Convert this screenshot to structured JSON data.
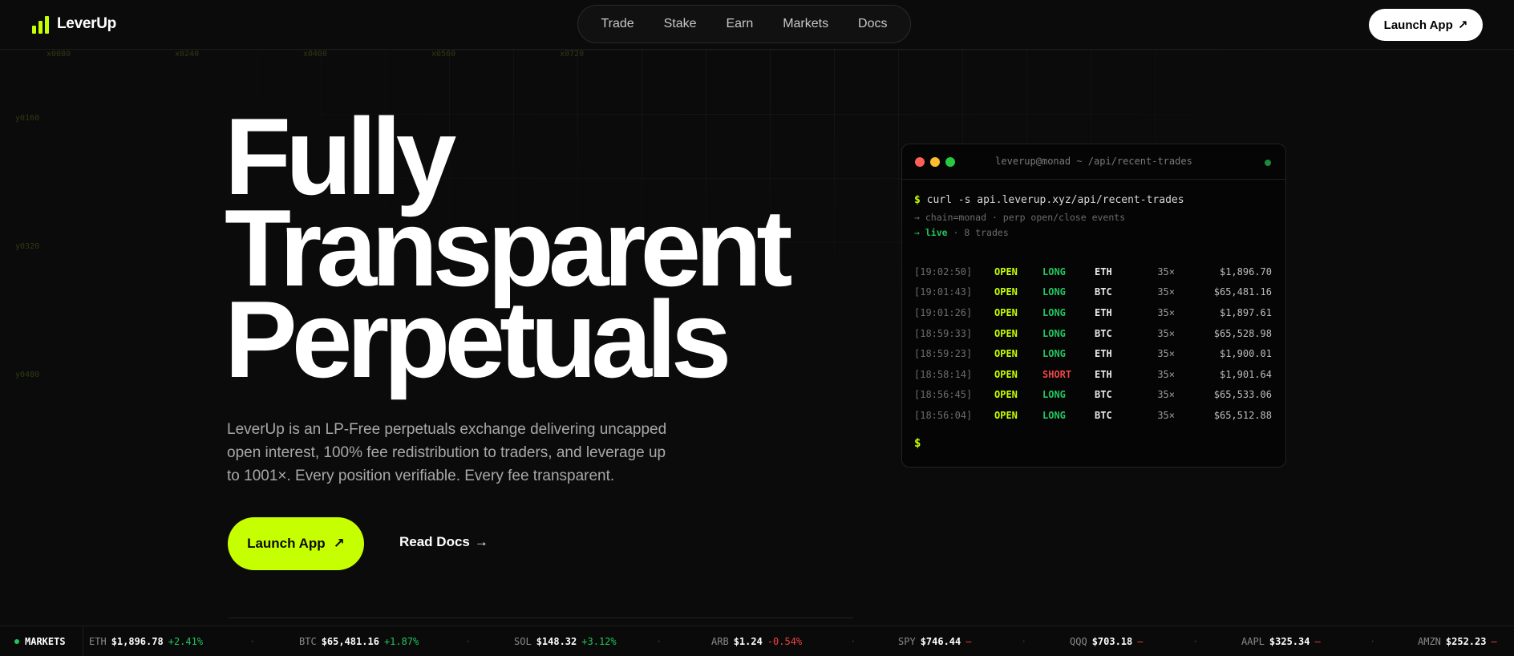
{
  "brand": {
    "name": "LeverUp",
    "accent": "#c6ff00"
  },
  "nav": {
    "links": [
      "Trade",
      "Stake",
      "Earn",
      "Markets",
      "Docs"
    ],
    "cta_label": "Launch App",
    "cta_icon": "arrow-up-right-icon"
  },
  "grid_labels": {
    "x": [
      "x0080",
      "x0240",
      "x0400",
      "x0560",
      "x0720"
    ],
    "y": [
      "y0160",
      "y0320",
      "y0480"
    ]
  },
  "hero": {
    "title_lines": [
      "Fully",
      "Transparent",
      "Perpetuals"
    ],
    "description": "LeverUp is an LP-Free perpetuals exchange delivering uncapped open interest, 100% fee redistribution to traders, and leverage up to 1001×. Every position verifiable. Every fee transparent.",
    "primary_label": "Launch App",
    "primary_icon": "arrow-up-right-icon",
    "secondary_label": "Read Docs",
    "secondary_icon": "arrow-right-icon"
  },
  "terminal": {
    "title": "leverup@monad ~ /api/recent-trades",
    "prompt_symbol": "$",
    "command": "curl -s api.leverup.xyz/api/recent-trades",
    "arrow": "→",
    "meta1": "chain=monad · perp open/close events",
    "live_label": "live",
    "meta2_rest": "· 8 trades",
    "trades": [
      {
        "time": "[19:02:50]",
        "action": "OPEN",
        "side": "LONG",
        "asset": "ETH",
        "lev": "35×",
        "price": "$1,896.70"
      },
      {
        "time": "[19:01:43]",
        "action": "OPEN",
        "side": "LONG",
        "asset": "BTC",
        "lev": "35×",
        "price": "$65,481.16"
      },
      {
        "time": "[19:01:26]",
        "action": "OPEN",
        "side": "LONG",
        "asset": "ETH",
        "lev": "35×",
        "price": "$1,897.61"
      },
      {
        "time": "[18:59:33]",
        "action": "OPEN",
        "side": "LONG",
        "asset": "BTC",
        "lev": "35×",
        "price": "$65,528.98"
      },
      {
        "time": "[18:59:23]",
        "action": "OPEN",
        "side": "LONG",
        "asset": "ETH",
        "lev": "35×",
        "price": "$1,900.01"
      },
      {
        "time": "[18:58:14]",
        "action": "OPEN",
        "side": "SHORT",
        "asset": "ETH",
        "lev": "35×",
        "price": "$1,901.64"
      },
      {
        "time": "[18:56:45]",
        "action": "OPEN",
        "side": "LONG",
        "asset": "BTC",
        "lev": "35×",
        "price": "$65,533.06"
      },
      {
        "time": "[18:56:04]",
        "action": "OPEN",
        "side": "LONG",
        "asset": "BTC",
        "lev": "35×",
        "price": "$65,512.88"
      }
    ],
    "colors": {
      "long": "#22c55e",
      "short": "#ef4444",
      "dot_red": "#ff5f57",
      "dot_yellow": "#febc2e",
      "dot_green": "#28c840"
    }
  },
  "ticker": {
    "label": "MARKETS",
    "separator": "·",
    "items": [
      {
        "symbol": "ETH",
        "price": "$1,896.78",
        "change": "+2.41%",
        "dir": "up"
      },
      {
        "symbol": "BTC",
        "price": "$65,481.16",
        "change": "+1.87%",
        "dir": "up"
      },
      {
        "symbol": "SOL",
        "price": "$148.32",
        "change": "+3.12%",
        "dir": "up"
      },
      {
        "symbol": "ARB",
        "price": "$1.24",
        "change": "-0.54%",
        "dir": "down"
      },
      {
        "symbol": "SPY",
        "price": "$746.44",
        "change": "—",
        "dir": "down"
      },
      {
        "symbol": "QQQ",
        "price": "$703.18",
        "change": "—",
        "dir": "down"
      },
      {
        "symbol": "AAPL",
        "price": "$325.34",
        "change": "—",
        "dir": "down"
      },
      {
        "symbol": "AMZN",
        "price": "$252.23",
        "change": "—",
        "dir": "down"
      }
    ]
  }
}
